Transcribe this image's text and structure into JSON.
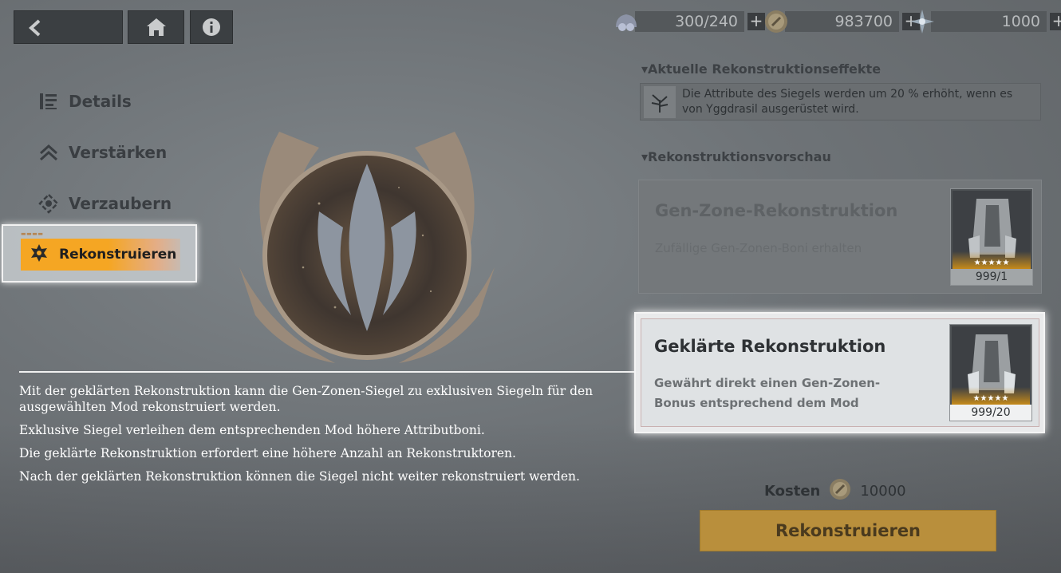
{
  "top_bar": {
    "back_icon": "back-arrow-icon",
    "home_icon": "home-icon",
    "info_icon": "info-icon",
    "resources": [
      {
        "icon": "energy-icon",
        "value": "300/240"
      },
      {
        "icon": "coin-icon",
        "value": "983700"
      },
      {
        "icon": "crystal-icon",
        "value": "1000"
      }
    ],
    "plus_label": "+"
  },
  "menu": {
    "items": [
      {
        "label": "Details",
        "icon": "details-icon"
      },
      {
        "label": "Verstärken",
        "icon": "chevron-up-icon"
      },
      {
        "label": "Verzaubern",
        "icon": "enchant-icon"
      },
      {
        "label": "Rekonstruieren",
        "icon": "reconstruct-icon",
        "selected": true
      }
    ]
  },
  "right_panel": {
    "effects_title": "Aktuelle Rekonstruktionseffekte",
    "effect_line1": "Die Attribute des Siegels werden um 20 % erhöht, wenn es",
    "effect_line2": "von Yggdrasil ausgerüstet wird.",
    "preview_title": "Rekonstruktionsvorschau",
    "option1": {
      "title": "Gen-Zone-Rekonstruktion",
      "subtitle": "Zufällige Gen-Zonen-Boni erhalten",
      "count": "999/1",
      "stars": "★★★★★"
    },
    "option2": {
      "title": "Geklärte Rekonstruktion",
      "subtitle": "Gewährt direkt einen Gen-Zonen-Bonus entsprechend dem Mod",
      "count": "999/20",
      "stars": "★★★★★"
    },
    "cost_label": "Kosten",
    "cost_value": "10000",
    "action_button": "Rekonstruieren"
  },
  "tutorial": {
    "line1": "Mit der geklärten Rekonstruktion kann die Gen-Zonen-Siegel zu exklusiven Siegeln für den ausgewählten Mod rekonstruiert werden.",
    "line2": "Exklusive Siegel verleihen dem entsprechenden Mod höhere Attributboni.",
    "line3": "Die geklärte Rekonstruktion erfordert eine höhere Anzahl an Rekonstruktoren.",
    "line4": "Nach der geklärten Rekonstruktion können die Siegel nicht weiter rekonstruiert werden."
  },
  "colors": {
    "accent": "#f5a623",
    "highlight_frame": "#f4f4f4",
    "button": "#b98f3c"
  }
}
